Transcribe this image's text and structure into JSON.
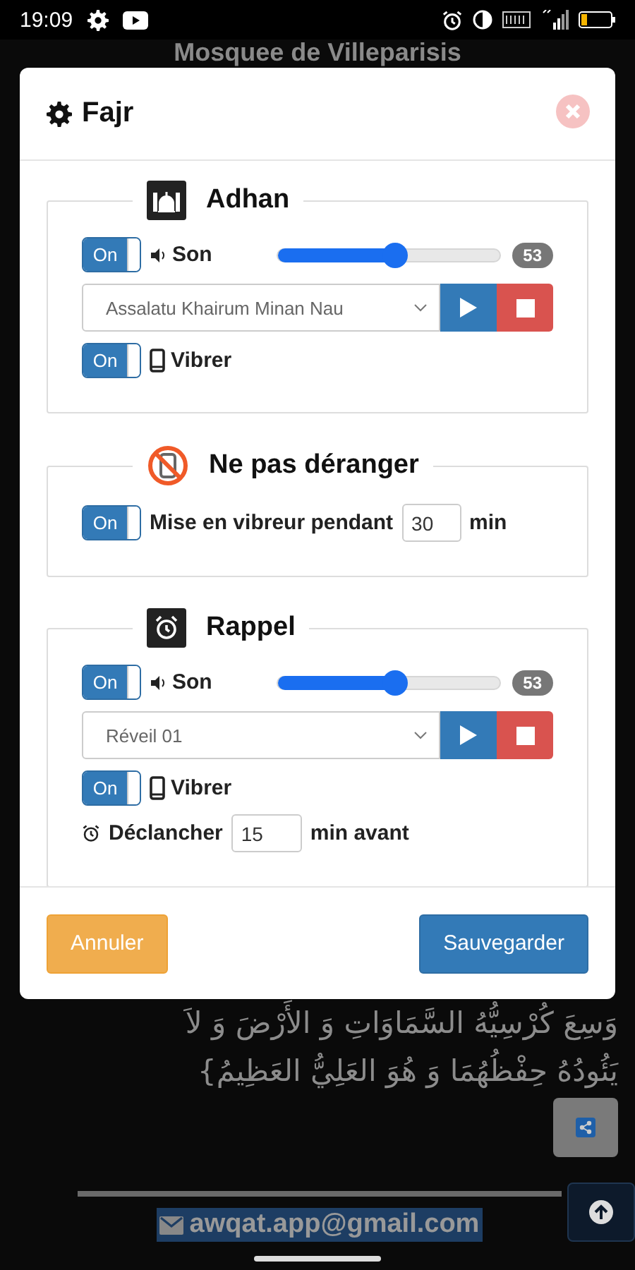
{
  "status_bar": {
    "time": "19:09"
  },
  "app": {
    "title": "Mosquee de Villeparisis",
    "verse_lines": [
      "وَسِعَ كُرْسِيُّهُ السَّمَاوَاتِ وَ الأَرْضَ وَ لاَ",
      "يَئُودُهُ حِفْظُهُمَا وَ هُوَ العَلِيُّ العَظِيمُ}"
    ],
    "email": "awqat.app@gmail.com"
  },
  "dialog": {
    "title": "Fajr",
    "sections": [
      {
        "kind": "adhan",
        "title": "Adhan",
        "sound": {
          "toggle": "On",
          "on": true,
          "label": "Son",
          "level": 0.53,
          "reading": "53",
          "track": "Assalatu Khairum Minan Nau"
        },
        "vibrate": {
          "toggle": "On",
          "on": true,
          "label": "Vibrer"
        }
      },
      {
        "kind": "dnd",
        "title": "Ne pas déranger",
        "silent": {
          "toggle": "On",
          "on": true,
          "label": "Mise en vibreur pendant",
          "value": "30",
          "unit": "min"
        }
      },
      {
        "kind": "reminder",
        "title": "Rappel",
        "sound": {
          "toggle": "On",
          "on": true,
          "label": "Son",
          "level": 0.53,
          "reading": "53",
          "track": "Réveil 01"
        },
        "vibrate": {
          "toggle": "On",
          "on": true,
          "label": "Vibrer"
        },
        "trigger": {
          "label": "Déclancher",
          "value": "15",
          "unit": "min avant"
        }
      }
    ],
    "buttons": {
      "cancel": "Annuler",
      "save": "Sauvegarder"
    }
  }
}
